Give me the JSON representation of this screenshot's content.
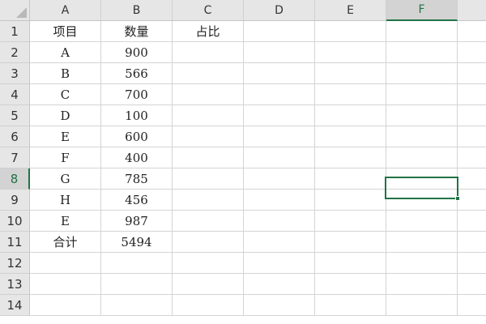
{
  "columns": [
    "A",
    "B",
    "C",
    "D",
    "E",
    "F",
    ""
  ],
  "active_column": "F",
  "active_row": 8,
  "selected_cell": "F8",
  "colors": {
    "accent": "#217346",
    "header_bg": "#e6e6e6",
    "grid": "#d4d4d4"
  },
  "rows": [
    {
      "num": "1",
      "cells": [
        "项目",
        "数量",
        "占比",
        "",
        "",
        "",
        ""
      ]
    },
    {
      "num": "2",
      "cells": [
        "A",
        "900",
        "",
        "",
        "",
        "",
        ""
      ]
    },
    {
      "num": "3",
      "cells": [
        "B",
        "566",
        "",
        "",
        "",
        "",
        ""
      ]
    },
    {
      "num": "4",
      "cells": [
        "C",
        "700",
        "",
        "",
        "",
        "",
        ""
      ]
    },
    {
      "num": "5",
      "cells": [
        "D",
        "100",
        "",
        "",
        "",
        "",
        ""
      ]
    },
    {
      "num": "6",
      "cells": [
        "E",
        "600",
        "",
        "",
        "",
        "",
        ""
      ]
    },
    {
      "num": "7",
      "cells": [
        "F",
        "400",
        "",
        "",
        "",
        "",
        ""
      ]
    },
    {
      "num": "8",
      "cells": [
        "G",
        "785",
        "",
        "",
        "",
        "",
        ""
      ]
    },
    {
      "num": "9",
      "cells": [
        "H",
        "456",
        "",
        "",
        "",
        "",
        ""
      ]
    },
    {
      "num": "10",
      "cells": [
        "E",
        "987",
        "",
        "",
        "",
        "",
        ""
      ]
    },
    {
      "num": "11",
      "cells": [
        "合计",
        "5494",
        "",
        "",
        "",
        "",
        ""
      ]
    },
    {
      "num": "12",
      "cells": [
        "",
        "",
        "",
        "",
        "",
        "",
        ""
      ]
    },
    {
      "num": "13",
      "cells": [
        "",
        "",
        "",
        "",
        "",
        "",
        ""
      ]
    },
    {
      "num": "14",
      "cells": [
        "",
        "",
        "",
        "",
        "",
        "",
        ""
      ]
    }
  ]
}
